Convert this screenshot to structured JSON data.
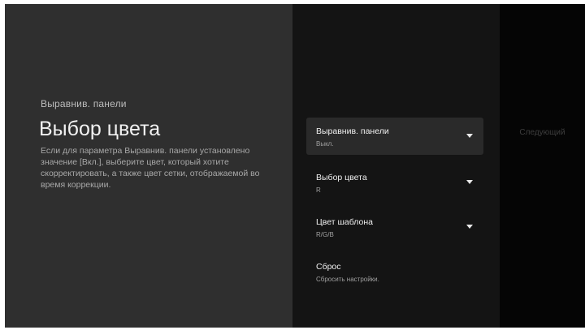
{
  "header": {
    "breadcrumb": "Выравнив. панели",
    "title": "Выбор цвета",
    "description": "Если для параметра Выравнив. панели установлено значение [Вкл.], выберите цвет, который хотите скорректировать, а также цвет сетки, отображаемой во время коррекции."
  },
  "menu": {
    "items": [
      {
        "label": "Выравнив. панели",
        "value": "Выкл.",
        "icon": "chevron-down-icon",
        "focused": true
      },
      {
        "label": "Выбор цвета",
        "value": "R",
        "icon": "chevron-down-icon",
        "focused": false
      },
      {
        "label": "Цвет шаблона",
        "value": "R/G/B",
        "icon": "chevron-down-icon",
        "focused": false
      },
      {
        "label": "Сброс",
        "value": "Сбросить настройки.",
        "icon": "",
        "focused": false
      }
    ]
  },
  "next": {
    "label": "Следующий"
  },
  "colors": {
    "left_panel": "#2f2f2f",
    "menu_panel": "#141414",
    "focused_item": "#2a2a2a",
    "right_panel": "#050505",
    "text_primary": "#f0f0f0",
    "text_secondary": "#a8a8a8",
    "text_disabled": "#3e3e3e"
  }
}
